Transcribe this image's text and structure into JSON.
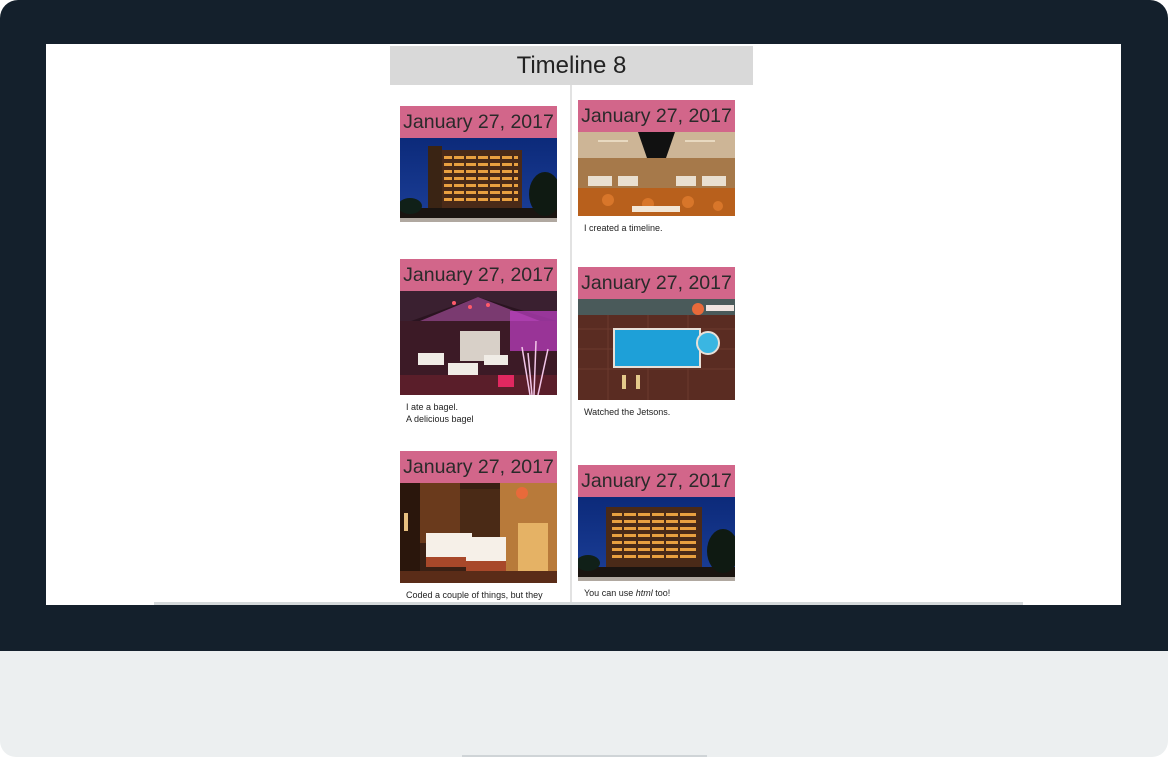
{
  "page": {
    "title": "Timeline 8"
  },
  "timeline": {
    "left": [
      {
        "date": "January 27, 2017",
        "image": "hotel-exterior-night",
        "caption": ""
      },
      {
        "date": "January 27, 2017",
        "image": "restaurant-interior-pink",
        "caption_lines": [
          "I ate a bagel.",
          "A delicious bagel"
        ]
      },
      {
        "date": "January 27, 2017",
        "image": "hotel-bedroom-twin",
        "caption": "Coded a couple of things, but they"
      }
    ],
    "right": [
      {
        "date": "January 27, 2017",
        "image": "banquet-hall",
        "caption": "I created a timeline."
      },
      {
        "date": "January 27, 2017",
        "image": "rooftop-pool",
        "caption": "Watched the Jetsons."
      },
      {
        "date": "January 27, 2017",
        "image": "hotel-exterior-night",
        "caption_pre": "You can use ",
        "caption_em": "html",
        "caption_post": " too!"
      }
    ]
  },
  "colors": {
    "accent": "#d2668a",
    "title_bar": "#d9d9d9",
    "bezel": "#14202c",
    "stand": "#eceff0"
  }
}
